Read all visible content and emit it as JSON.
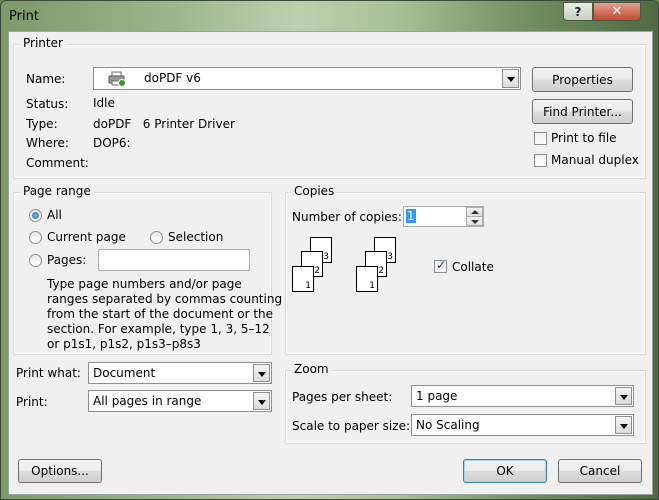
{
  "window": {
    "title": "Print",
    "help_label": "?",
    "close_label": "✕"
  },
  "printer": {
    "group_label": "Printer",
    "name_label": "Name:",
    "selected_printer": "doPDF v6",
    "status_label": "Status:",
    "status_value": "Idle",
    "type_label": "Type:",
    "type_value": "doPDF   6 Printer Driver",
    "where_label": "Where:",
    "where_value": "DOP6:",
    "comment_label": "Comment:",
    "comment_value": "",
    "properties_button": "Properties",
    "find_printer_button": "Find Printer...",
    "print_to_file_label": "Print to file",
    "manual_duplex_label": "Manual duplex"
  },
  "page_range": {
    "group_label": "Page range",
    "all_label": "All",
    "current_page_label": "Current page",
    "selection_label": "Selection",
    "pages_label": "Pages:",
    "pages_value": "",
    "help_text": [
      "Type page numbers and/or page",
      "ranges separated by commas counting",
      "from the start of the document or the",
      "section. For example, type 1, 3, 5–12",
      "or p1s1, p1s2, p1s3–p8s3"
    ]
  },
  "copies": {
    "group_label": "Copies",
    "number_label": "Number of copies:",
    "number_value": "1",
    "collate_label": "Collate",
    "collate_checked": true,
    "pages": [
      "3",
      "2",
      "1",
      "3",
      "2",
      "1"
    ]
  },
  "print_what": {
    "label": "Print what:",
    "value": "Document"
  },
  "print": {
    "label": "Print:",
    "value": "All pages in range"
  },
  "zoom": {
    "group_label": "Zoom",
    "pages_per_sheet_label": "Pages per sheet:",
    "pages_per_sheet_value": "1 page",
    "scale_label": "Scale to paper size:",
    "scale_value": "No Scaling"
  },
  "footer": {
    "options_button": "Options...",
    "ok_button": "OK",
    "cancel_button": "Cancel"
  }
}
